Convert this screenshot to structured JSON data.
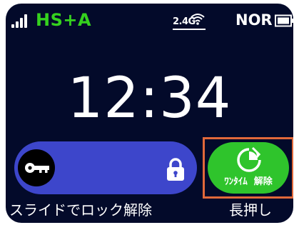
{
  "status_bar": {
    "network": "HS+A",
    "band": "2.4G",
    "mode": "NOR",
    "network_color": "#35d11e",
    "icons": [
      "signal-icon",
      "wifi-icon",
      "battery-icon"
    ]
  },
  "clock": {
    "time": "12:34"
  },
  "slide_unlock": {
    "caption": "スライドでロック解除",
    "color": "#3d46cb",
    "icons": [
      "key-icon",
      "lock-icon"
    ]
  },
  "onetime_unlock": {
    "label": "ﾜﾝﾀｲﾑ  解除",
    "caption": "長押し",
    "color": "#2fc42c",
    "highlight_color": "#e1683a",
    "icons": [
      "timer-icon"
    ]
  }
}
